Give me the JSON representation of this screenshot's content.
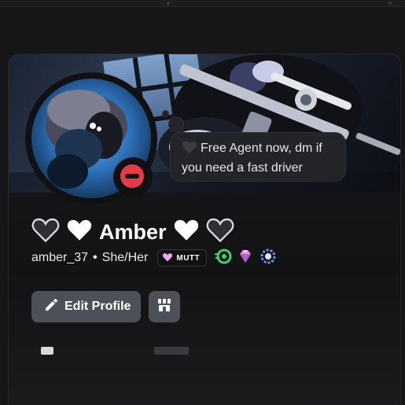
{
  "profile": {
    "display_name": "Amber",
    "username": "amber_37",
    "pronouns": "She/Her",
    "separator": "•",
    "status": "do-not-disturb",
    "custom_status": "Free Agent now, dm if you need a fast driver",
    "server_tag": "MUTT",
    "name_decorations": [
      "black-heart-icon",
      "white-heart-icon",
      "white-heart-icon",
      "black-heart-icon"
    ],
    "badges": [
      "green-speed-badge-icon",
      "pink-gem-badge-icon",
      "laurel-ring-badge-icon"
    ]
  },
  "actions": {
    "edit_profile_label": "Edit Profile",
    "shop_icon": "shop-icon"
  },
  "colors": {
    "status_dnd": "#e23c4a",
    "button_bg": "#4e5058",
    "badge_green": "#3fd16b",
    "badge_pink": "#e889e8",
    "badge_blue": "#6f8ff0",
    "tag_heart": "#f0a5e8"
  }
}
